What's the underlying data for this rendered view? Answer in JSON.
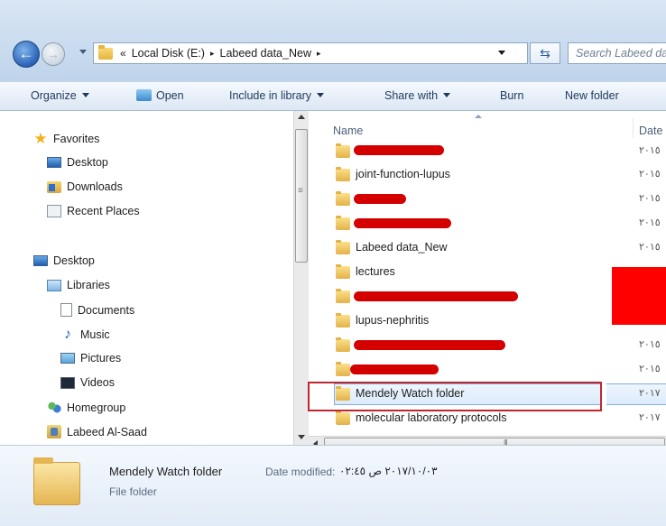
{
  "address": {
    "segments": [
      "Local Disk (E:)",
      "Labeed data_New"
    ],
    "overflow_chevron": "«",
    "separator": "▸",
    "search_placeholder": "Search Labeed data_New"
  },
  "toolbar": {
    "organize": "Organize",
    "open": "Open",
    "include_in_library": "Include in library",
    "share_with": "Share with",
    "burn": "Burn",
    "new_folder": "New folder"
  },
  "nav": {
    "favorites": "Favorites",
    "fav_desktop": "Desktop",
    "downloads": "Downloads",
    "recent_places": "Recent Places",
    "desktop": "Desktop",
    "libraries": "Libraries",
    "documents": "Documents",
    "music": "Music",
    "pictures": "Pictures",
    "videos": "Videos",
    "homegroup": "Homegroup",
    "user": "Labeed Al-Saad"
  },
  "columns": {
    "name": "Name",
    "date": "Date"
  },
  "files": {
    "r0": {
      "name": "",
      "date": "٢٠١٥"
    },
    "r1": {
      "name": "joint-function-lupus",
      "date": "٢٠١٥"
    },
    "r2": {
      "name": "",
      "date": "٢٠١٥"
    },
    "r3": {
      "name": "",
      "date": "٢٠١٥"
    },
    "r4": {
      "name": "Labeed data_New",
      "date": "٢٠١٥"
    },
    "r5": {
      "name": "lectures",
      "date": ""
    },
    "r6": {
      "name": "",
      "date": ""
    },
    "r7": {
      "name": "lupus-nephritis",
      "date": ""
    },
    "r8": {
      "name": "",
      "date": "٢٠١٥"
    },
    "r9": {
      "name": "",
      "date": "٢٠١٥"
    },
    "r10": {
      "name": "Mendely Watch folder",
      "date": "٢٠١٧"
    },
    "r11": {
      "name": "molecular laboratory protocols",
      "date": "٢٠١٧"
    }
  },
  "details": {
    "name": "Mendely Watch folder",
    "modified_label": "Date modified:",
    "modified_value": "٢٠١٧/١٠/٠٣ ص ٠٢:٤٥",
    "type": "File folder"
  },
  "colors": {
    "highlight_border": "#c0272d",
    "redaction": "#d40000",
    "red_block": "#ff0000"
  }
}
